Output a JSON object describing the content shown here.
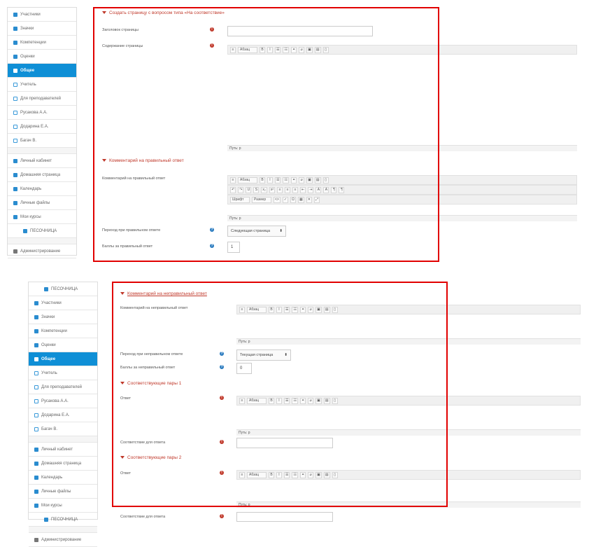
{
  "top": {
    "sidebar": {
      "items": [
        {
          "label": "Участники",
          "icon": "users-icon"
        },
        {
          "label": "Значки",
          "icon": "badge-icon"
        },
        {
          "label": "Компетенции",
          "icon": "check-icon"
        },
        {
          "label": "Оценки",
          "icon": "grades-icon"
        },
        {
          "label": "Общее",
          "icon": "folder-icon",
          "active": true
        },
        {
          "label": "Учитель",
          "icon": "folder-icon"
        },
        {
          "label": "Для преподавателей",
          "icon": "folder-icon"
        },
        {
          "label": "Русакова А.А.",
          "icon": "folder-icon"
        },
        {
          "label": "Додарина Е.А.",
          "icon": "folder-icon"
        },
        {
          "label": "Багач В.",
          "icon": "folder-icon"
        }
      ],
      "items2": [
        {
          "label": "Личный кабинет",
          "icon": "dashboard-icon"
        },
        {
          "label": "Домашняя страница",
          "icon": "home-icon"
        },
        {
          "label": "Календарь",
          "icon": "calendar-icon"
        },
        {
          "label": "Личные файлы",
          "icon": "file-icon"
        },
        {
          "label": "Мои курсы",
          "icon": "courses-icon"
        },
        {
          "label": "ПЕСОЧНИЦА",
          "icon": "course-icon",
          "indent": true
        }
      ],
      "admin": {
        "label": "Администрирование",
        "icon": "wrench-icon"
      }
    },
    "section1": "Создать страницу с вопросом типа «На соответствие»",
    "page_title_label": "Заголовок страницы",
    "page_content_label": "Содержание страницы",
    "path_label": "Путь: p",
    "section2": "Комментарий на правильный ответ",
    "comment_correct_label": "Комментарий на правильный ответ",
    "jump_correct_label": "Переход при правильном ответе",
    "jump_correct_value": "Следующая страница",
    "score_correct_label": "Баллы за правильный ответ",
    "score_correct_value": "1",
    "para_label": "Абзац",
    "font_label": "Шрифт",
    "size_label": "Размер"
  },
  "bottom": {
    "sidebar": {
      "items": [
        {
          "label": "ПЕСОЧНИЦА",
          "icon": "course-icon",
          "indent": true
        },
        {
          "label": "Участники",
          "icon": "users-icon"
        },
        {
          "label": "Значки",
          "icon": "badge-icon"
        },
        {
          "label": "Компетенции",
          "icon": "check-icon"
        },
        {
          "label": "Оценки",
          "icon": "grades-icon"
        },
        {
          "label": "Общее",
          "icon": "folder-icon",
          "active": true
        },
        {
          "label": "Учитель",
          "icon": "folder-icon"
        },
        {
          "label": "Для преподавателей",
          "icon": "folder-icon"
        },
        {
          "label": "Русакова А.А.",
          "icon": "folder-icon"
        },
        {
          "label": "Додарина Е.А.",
          "icon": "folder-icon"
        },
        {
          "label": "Багач В.",
          "icon": "folder-icon"
        }
      ],
      "items2": [
        {
          "label": "Личный кабинет",
          "icon": "dashboard-icon"
        },
        {
          "label": "Домашняя страница",
          "icon": "home-icon"
        },
        {
          "label": "Календарь",
          "icon": "calendar-icon"
        },
        {
          "label": "Личные файлы",
          "icon": "file-icon"
        },
        {
          "label": "Мои курсы",
          "icon": "courses-icon"
        },
        {
          "label": "ПЕСОЧНИЦА",
          "icon": "course-icon",
          "indent": true
        }
      ],
      "admin": {
        "label": "Администрирование",
        "icon": "wrench-icon"
      }
    },
    "section_wrong": "Комментарий на неправильный ответ",
    "comment_wrong_label": "Комментарий на неправильный ответ",
    "jump_wrong_label": "Переход при неправильном ответе",
    "jump_wrong_value": "Текущая страница",
    "score_wrong_label": "Баллы за неправильный ответ",
    "score_wrong_value": "0",
    "pair1": "Соответствующие пары 1",
    "answer_label": "Ответ",
    "match_label": "Соответствие для ответа",
    "pair2": "Соответствующие пары 2",
    "path_label": "Путь: p"
  },
  "colors": {
    "accent": "#0f8fd6",
    "red_box": "#e10000",
    "section_red": "#c0392b"
  }
}
